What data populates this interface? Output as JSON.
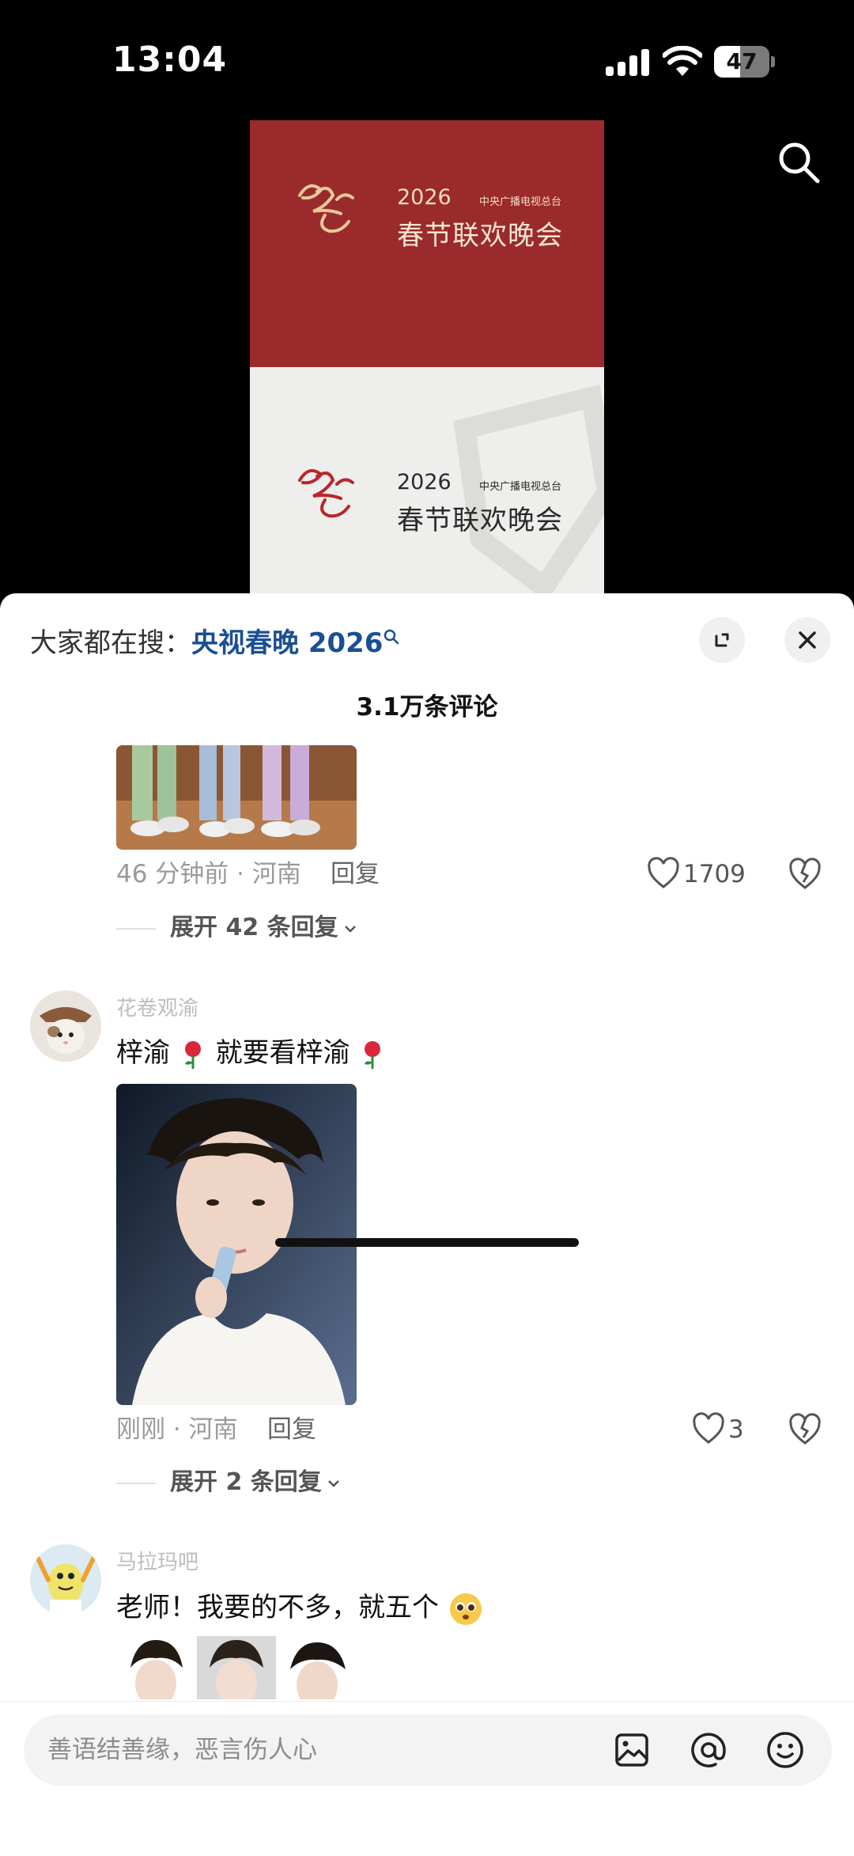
{
  "status_bar": {
    "time": "13:04",
    "battery": "47"
  },
  "poster": {
    "year": "2026",
    "organization": "中央广播电视总台",
    "event_title": "春节联欢晚会",
    "colors": {
      "top": "#9a2a2c",
      "bottom": "#eeeeec",
      "accent": "#e8c99a"
    }
  },
  "sheet": {
    "trending_label": "大家都在搜：",
    "trending_keyword": "央视春晚 2026",
    "comment_count": "3.1万条评论"
  },
  "comments": [
    {
      "meta": "46 分钟前 · 河南",
      "reply_label": "回复",
      "likes": "1709",
      "expand_label": "展开 42 条回复"
    },
    {
      "username": "花卷观渝",
      "text_part1": "梓渝",
      "text_part2": "就要看梓渝",
      "meta": "刚刚 · 河南",
      "reply_label": "回复",
      "likes": "3",
      "expand_label": "展开 2 条回复"
    },
    {
      "username": "马拉玛吧",
      "text": "老师！我要的不多，就五个"
    }
  ],
  "input": {
    "placeholder": "善语结善缘，恶言伤人心"
  },
  "icons": [
    "search-icon",
    "expand-icon",
    "close-icon",
    "heart-icon",
    "dislike-icon",
    "chevron-down-icon",
    "image-icon",
    "at-icon",
    "emoji-icon",
    "rose-icon"
  ],
  "colors": {
    "keyword": "#1a4f93",
    "meta": "#9a9a9a",
    "sheet_bg": "#ffffff"
  }
}
